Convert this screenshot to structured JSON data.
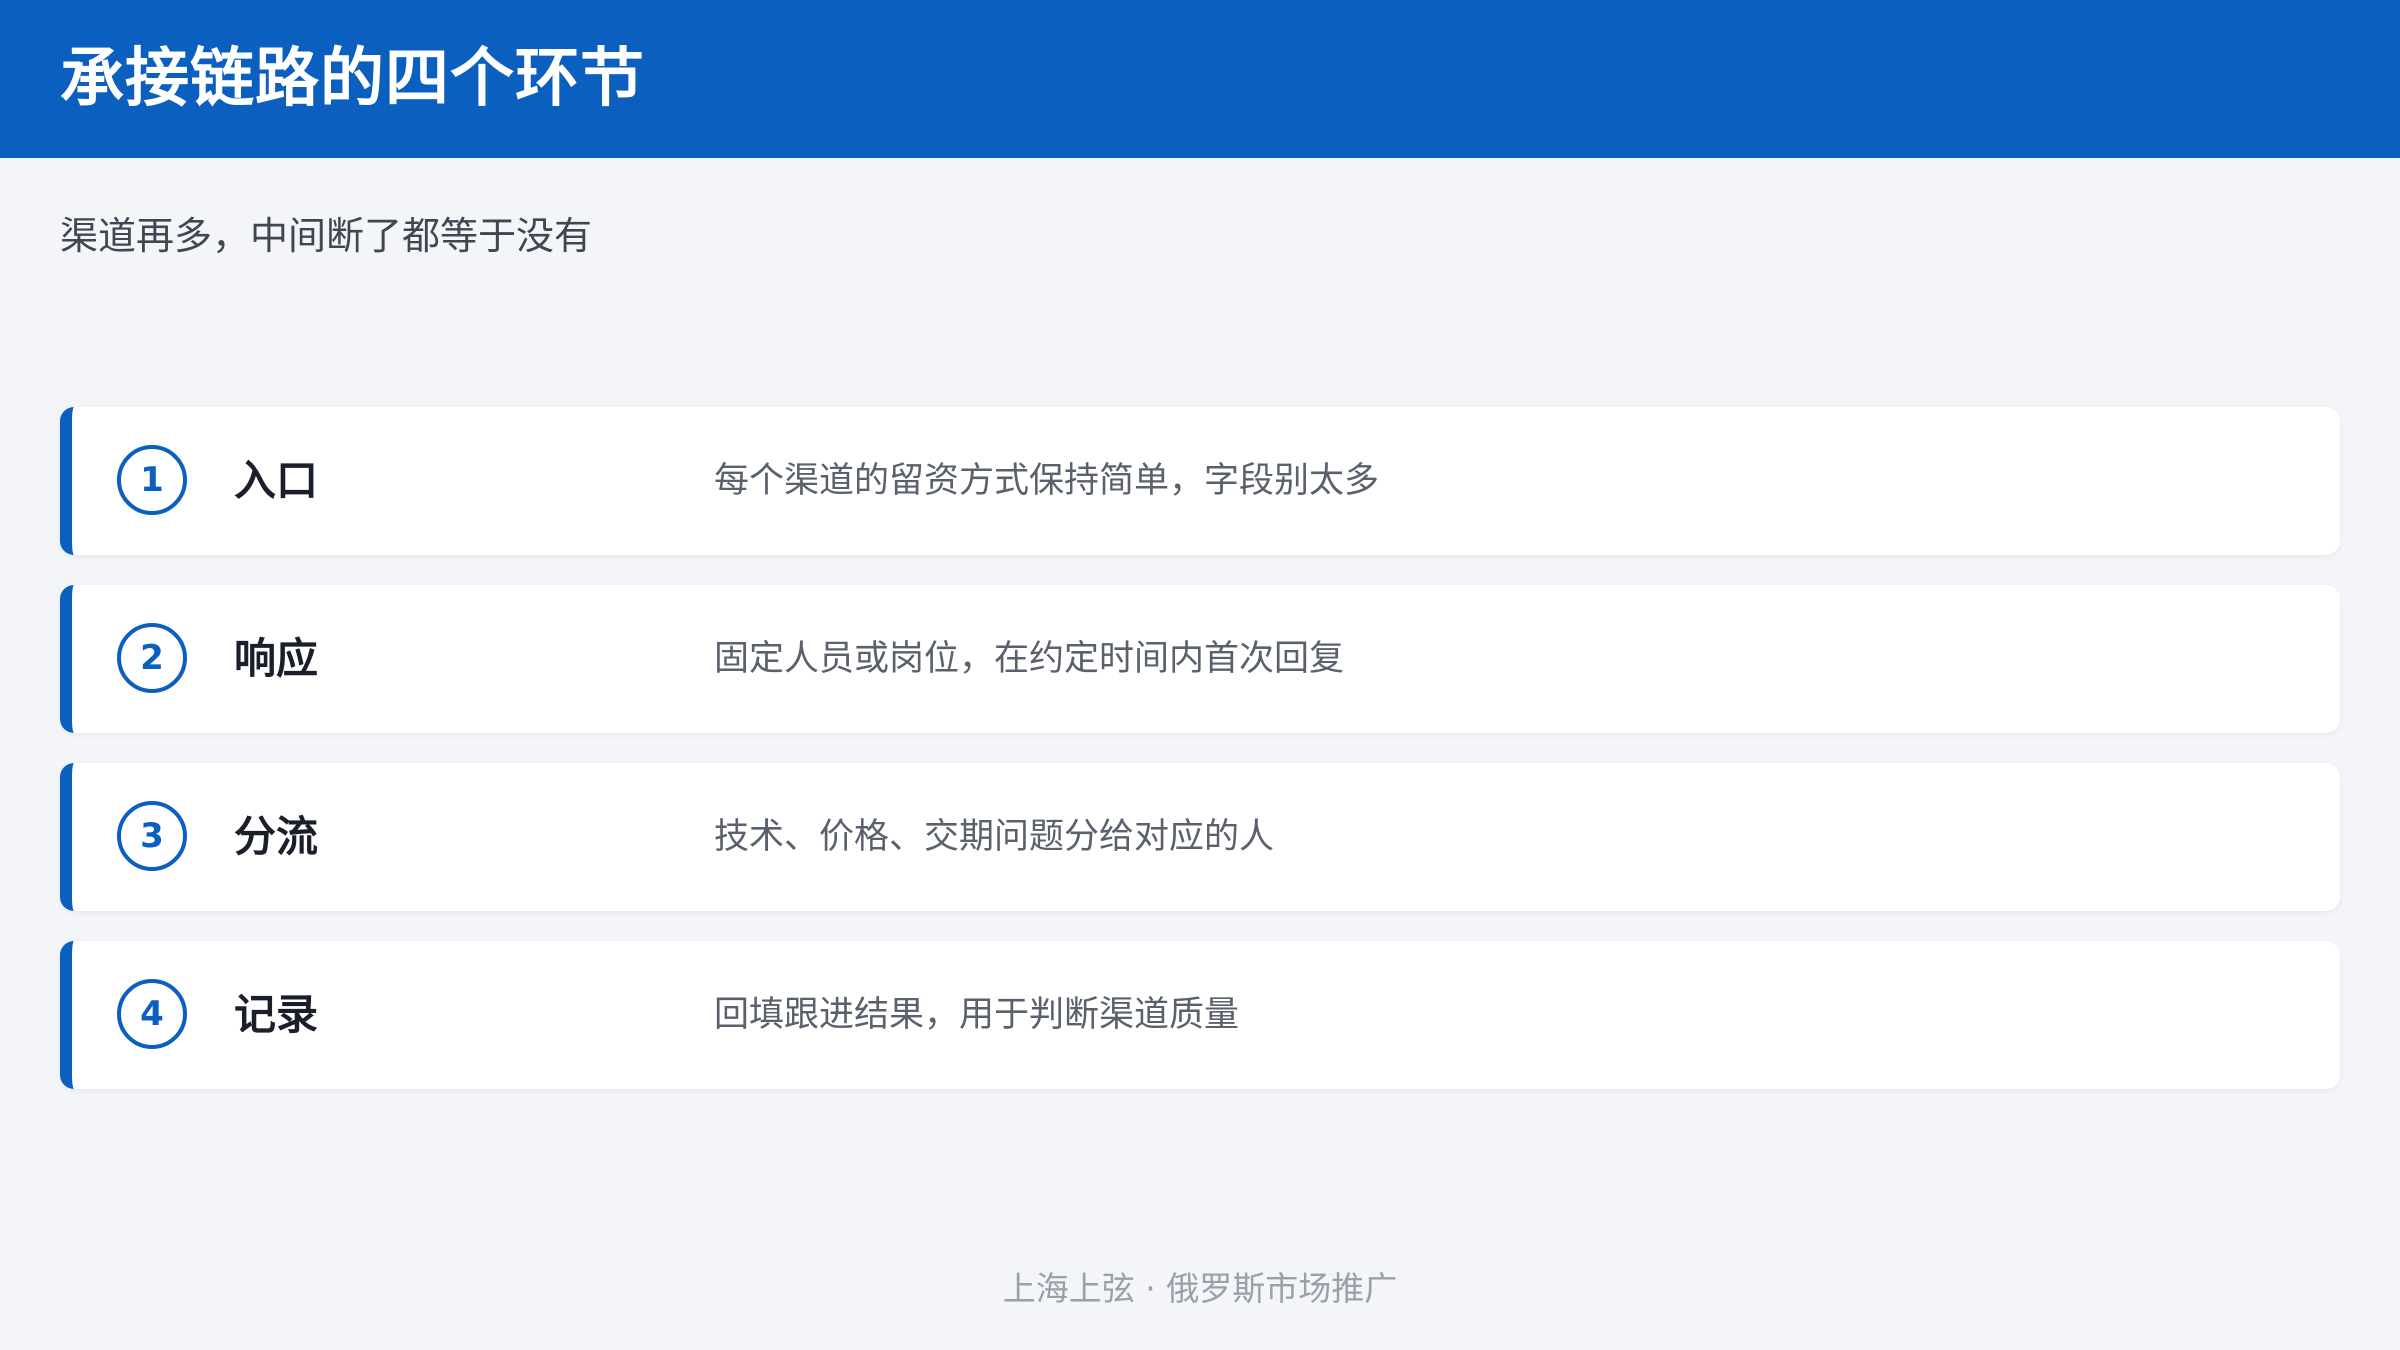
{
  "header": {
    "title": "承接链路的四个环节"
  },
  "subtitle": "渠道再多，中间断了都等于没有",
  "steps": [
    {
      "number": "1",
      "name": "入口",
      "description": "每个渠道的留资方式保持简单，字段别太多"
    },
    {
      "number": "2",
      "name": "响应",
      "description": "固定人员或岗位，在约定时间内首次回复"
    },
    {
      "number": "3",
      "name": "分流",
      "description": "技术、价格、交期问题分给对应的人"
    },
    {
      "number": "4",
      "name": "记录",
      "description": "回填跟进结果，用于判断渠道质量"
    }
  ],
  "footer": "上海上弦 · 俄罗斯市场推广",
  "colors": {
    "accent": "#0b5fbf",
    "background": "#f3f5f9",
    "card": "#ffffff"
  }
}
